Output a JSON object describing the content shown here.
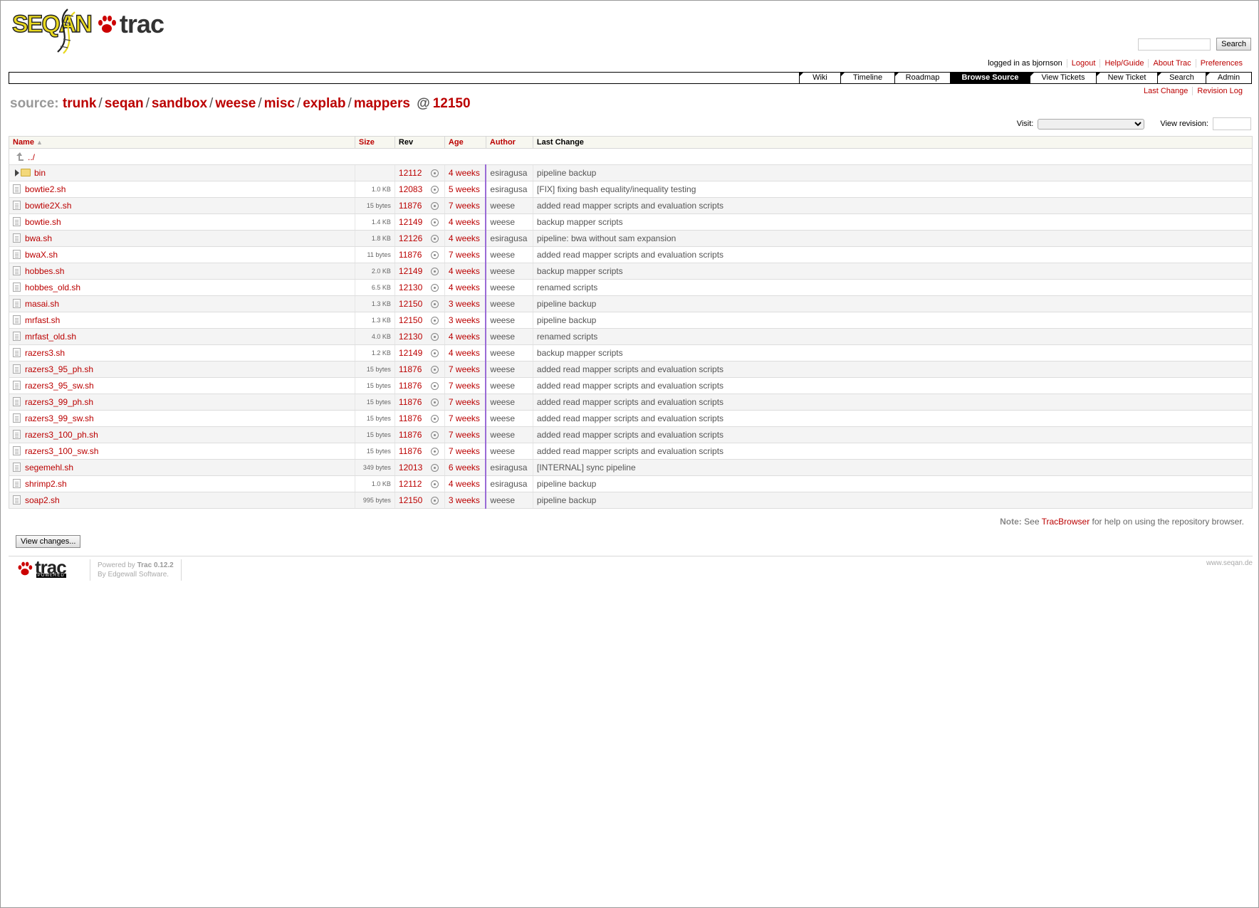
{
  "header": {
    "logo_text": "SEQAN",
    "trac_text": "trac",
    "search_button": "Search",
    "search_value": ""
  },
  "metanav": [
    "logged in as bjornson",
    "Logout",
    "Help/Guide",
    "About Trac",
    "Preferences"
  ],
  "mainnav": [
    {
      "label": "Wiki",
      "w": 58
    },
    {
      "label": "Timeline",
      "w": 76
    },
    {
      "label": "Roadmap",
      "w": 78
    },
    {
      "label": "Browse Source",
      "w": 112,
      "active": true
    },
    {
      "label": "View Tickets",
      "w": 93
    },
    {
      "label": "New Ticket",
      "w": 86
    },
    {
      "label": "Search",
      "w": 68
    },
    {
      "label": "Admin",
      "w": 64
    }
  ],
  "ctxtnav": [
    "Last Change",
    "Revision Log"
  ],
  "path": {
    "prefix": "source:",
    "segments": [
      "trunk",
      "seqan",
      "sandbox",
      "weese",
      "misc",
      "explab",
      "mappers"
    ],
    "at": "@",
    "revision": "12150"
  },
  "visit_label": "Visit:",
  "view_revision_label": "View revision:",
  "columns": {
    "name": "Name",
    "size": "Size",
    "rev": "Rev",
    "age": "Age",
    "author": "Author",
    "change": "Last Change"
  },
  "parent_link": "../",
  "rows": [
    {
      "name": "bin",
      "dir": true,
      "size": "",
      "rev": "12112",
      "age": "4 weeks",
      "author": "esiragusa",
      "change": "pipeline backup"
    },
    {
      "name": "bowtie2.sh",
      "size": "1.0 KB",
      "rev": "12083",
      "age": "5 weeks",
      "author": "esiragusa",
      "change": "[FIX] fixing bash equality/inequality testing"
    },
    {
      "name": "bowtie2X.sh",
      "size": "15 bytes",
      "rev": "11876",
      "age": "7 weeks",
      "author": "weese",
      "change": "added read mapper scripts and evaluation scripts"
    },
    {
      "name": "bowtie.sh",
      "size": "1.4 KB",
      "rev": "12149",
      "age": "4 weeks",
      "author": "weese",
      "change": "backup mapper scripts"
    },
    {
      "name": "bwa.sh",
      "size": "1.8 KB",
      "rev": "12126",
      "age": "4 weeks",
      "author": "esiragusa",
      "change": "pipeline: bwa without sam expansion"
    },
    {
      "name": "bwaX.sh",
      "size": "11 bytes",
      "rev": "11876",
      "age": "7 weeks",
      "author": "weese",
      "change": "added read mapper scripts and evaluation scripts"
    },
    {
      "name": "hobbes.sh",
      "size": "2.0 KB",
      "rev": "12149",
      "age": "4 weeks",
      "author": "weese",
      "change": "backup mapper scripts"
    },
    {
      "name": "hobbes_old.sh",
      "size": "6.5 KB",
      "rev": "12130",
      "age": "4 weeks",
      "author": "weese",
      "change": "renamed scripts"
    },
    {
      "name": "masai.sh",
      "size": "1.3 KB",
      "rev": "12150",
      "age": "3 weeks",
      "author": "weese",
      "change": "pipeline backup"
    },
    {
      "name": "mrfast.sh",
      "size": "1.3 KB",
      "rev": "12150",
      "age": "3 weeks",
      "author": "weese",
      "change": "pipeline backup"
    },
    {
      "name": "mrfast_old.sh",
      "size": "4.0 KB",
      "rev": "12130",
      "age": "4 weeks",
      "author": "weese",
      "change": "renamed scripts"
    },
    {
      "name": "razers3.sh",
      "size": "1.2 KB",
      "rev": "12149",
      "age": "4 weeks",
      "author": "weese",
      "change": "backup mapper scripts"
    },
    {
      "name": "razers3_95_ph.sh",
      "size": "15 bytes",
      "rev": "11876",
      "age": "7 weeks",
      "author": "weese",
      "change": "added read mapper scripts and evaluation scripts"
    },
    {
      "name": "razers3_95_sw.sh",
      "size": "15 bytes",
      "rev": "11876",
      "age": "7 weeks",
      "author": "weese",
      "change": "added read mapper scripts and evaluation scripts"
    },
    {
      "name": "razers3_99_ph.sh",
      "size": "15 bytes",
      "rev": "11876",
      "age": "7 weeks",
      "author": "weese",
      "change": "added read mapper scripts and evaluation scripts"
    },
    {
      "name": "razers3_99_sw.sh",
      "size": "15 bytes",
      "rev": "11876",
      "age": "7 weeks",
      "author": "weese",
      "change": "added read mapper scripts and evaluation scripts"
    },
    {
      "name": "razers3_100_ph.sh",
      "size": "15 bytes",
      "rev": "11876",
      "age": "7 weeks",
      "author": "weese",
      "change": "added read mapper scripts and evaluation scripts"
    },
    {
      "name": "razers3_100_sw.sh",
      "size": "15 bytes",
      "rev": "11876",
      "age": "7 weeks",
      "author": "weese",
      "change": "added read mapper scripts and evaluation scripts"
    },
    {
      "name": "segemehl.sh",
      "size": "349 bytes",
      "rev": "12013",
      "age": "6 weeks",
      "author": "esiragusa",
      "change": "[INTERNAL] sync pipeline"
    },
    {
      "name": "shrimp2.sh",
      "size": "1.0 KB",
      "rev": "12112",
      "age": "4 weeks",
      "author": "esiragusa",
      "change": "pipeline backup"
    },
    {
      "name": "soap2.sh",
      "size": "995 bytes",
      "rev": "12150",
      "age": "3 weeks",
      "author": "weese",
      "change": "pipeline backup"
    }
  ],
  "help": {
    "note": "Note:",
    "see": "See",
    "link": "TracBrowser",
    "rest": "for help on using the repository browser."
  },
  "view_changes_button": "View changes...",
  "footer": {
    "trac": "trac",
    "powered_badge": "POWERED",
    "powered_by": "Powered by",
    "trac_version": "Trac 0.12.2",
    "by": "By",
    "company": "Edgewall Software",
    "site": "www.seqan.de"
  }
}
